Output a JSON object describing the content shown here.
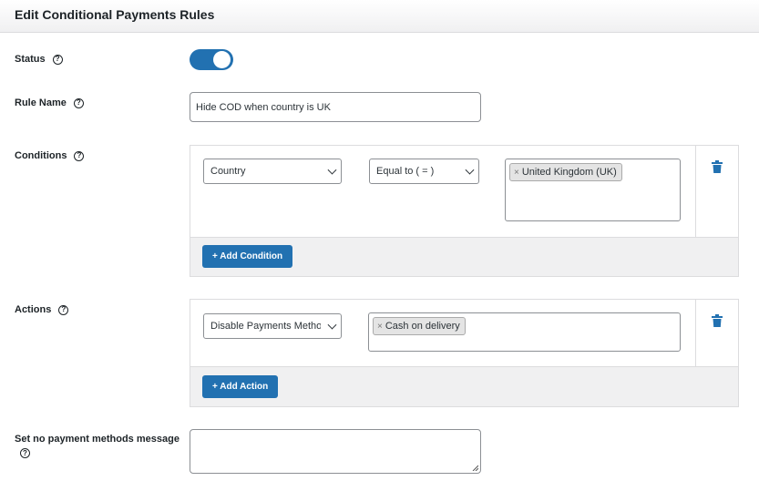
{
  "header": {
    "title": "Edit Conditional Payments Rules"
  },
  "status": {
    "label": "Status",
    "enabled": true
  },
  "rule_name": {
    "label": "Rule Name",
    "value": "Hide COD when country is UK"
  },
  "conditions": {
    "label": "Conditions",
    "field_select": "Country",
    "operator_select": "Equal to ( = )",
    "value_tags": [
      "United Kingdom (UK)"
    ],
    "add_button": "+ Add Condition"
  },
  "actions": {
    "label": "Actions",
    "action_select": "Disable Payments Methods",
    "value_tags": [
      "Cash on delivery"
    ],
    "add_button": "+ Add Action"
  },
  "no_payment_message": {
    "label": "Set no payment methods message",
    "value": ""
  },
  "icons": {
    "help": "?",
    "tag_remove": "×"
  },
  "colors": {
    "primary": "#2271b1",
    "trash": "#2271b1"
  }
}
